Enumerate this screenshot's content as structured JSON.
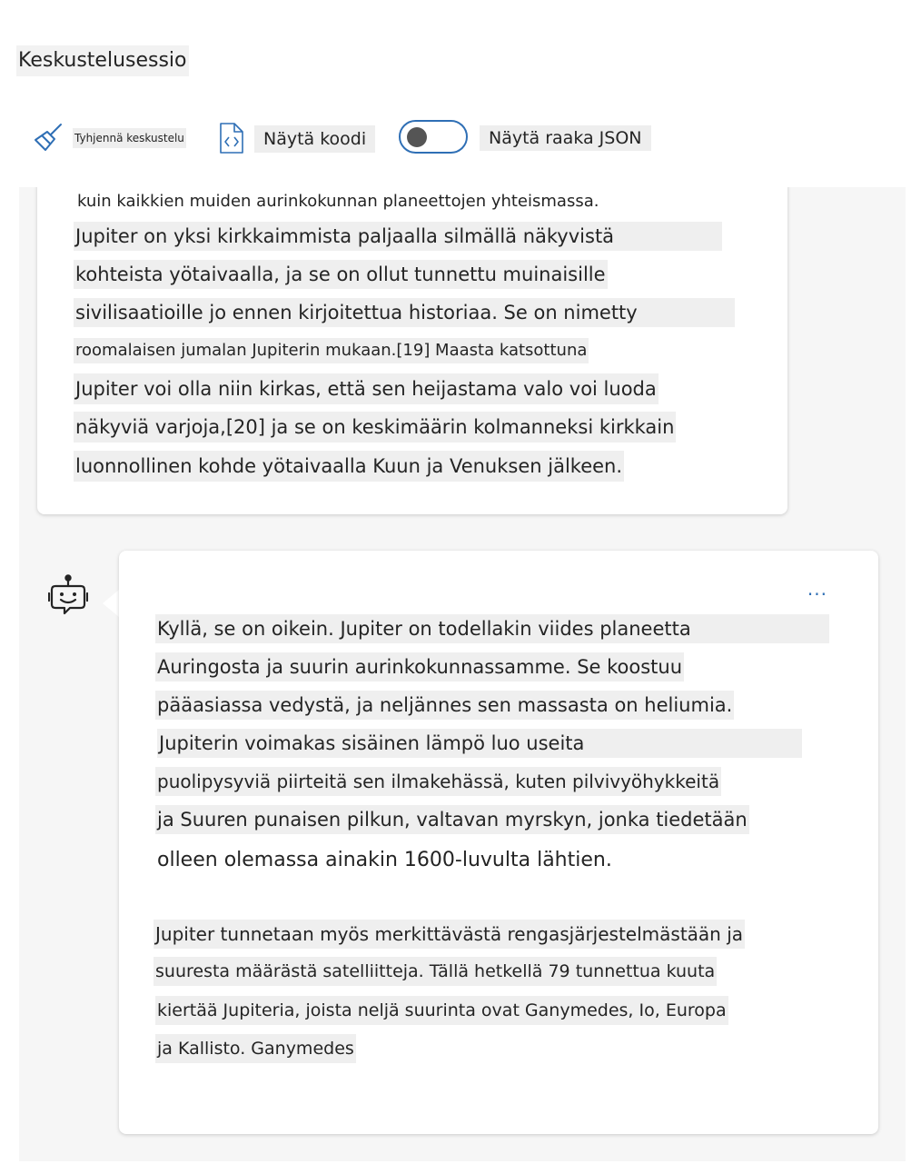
{
  "session": {
    "title": "Keskustelusessio"
  },
  "toolbar": {
    "clear_label": "Tyhjennä keskustelu",
    "view_code_label": "Näytä koodi",
    "raw_json_label": "Näytä raaka JSON",
    "raw_json_enabled": false,
    "clear_icon": "broom-icon",
    "code_icon": "code-file-icon"
  },
  "accent_color": "#2f6fb5",
  "messages": {
    "user_prev": {
      "lines": [
        "kuin kaikkien muiden aurinkokunnan planeettojen yhteismassa.",
        "Jupiter on yksi kirkkaimmista paljaalla silmällä näkyvistä",
        "kohteista yötaivaalla, ja se on ollut tunnettu muinaisille",
        "sivilisaatioille jo ennen kirjoitettua historiaa. Se on nimetty",
        "roomalaisen jumalan Jupiterin mukaan.[19] Maasta katsottuna",
        "Jupiter voi olla niin kirkas, että sen heijastama valo voi luoda",
        "näkyviä varjoja,[20] ja se on keskimäärin kolmanneksi kirkkain",
        "luonnollinen kohde yötaivaalla Kuun ja Venuksen jälkeen."
      ]
    },
    "bot": {
      "avatar_icon": "bot-icon",
      "more_label": "...",
      "paragraph1": [
        "Kyllä, se on oikein. Jupiter on todellakin viides planeetta",
        "Auringosta ja suurin aurinkokunnassamme. Se koostuu",
        "pääasiassa vedystä, ja neljännes sen massasta on heliumia.",
        "Jupiterin voimakas sisäinen lämpö luo useita",
        "puolipysyviä piirteitä sen ilmakehässä, kuten pilvivyöhykkeitä",
        "ja Suuren punaisen pilkun, valtavan myrskyn, jonka tiedetään",
        "olleen olemassa ainakin 1600-luvulta lähtien."
      ],
      "paragraph2": [
        "Jupiter tunnetaan myös merkittävästä rengasjärjestelmästään ja",
        "suuresta määrästä satelliitteja. Tällä hetkellä 79 tunnettua kuuta",
        "kiertää Jupiteria, joista neljä suurinta ovat Ganymedes, Io, Europa",
        "ja Kallisto. Ganymedes"
      ]
    }
  }
}
